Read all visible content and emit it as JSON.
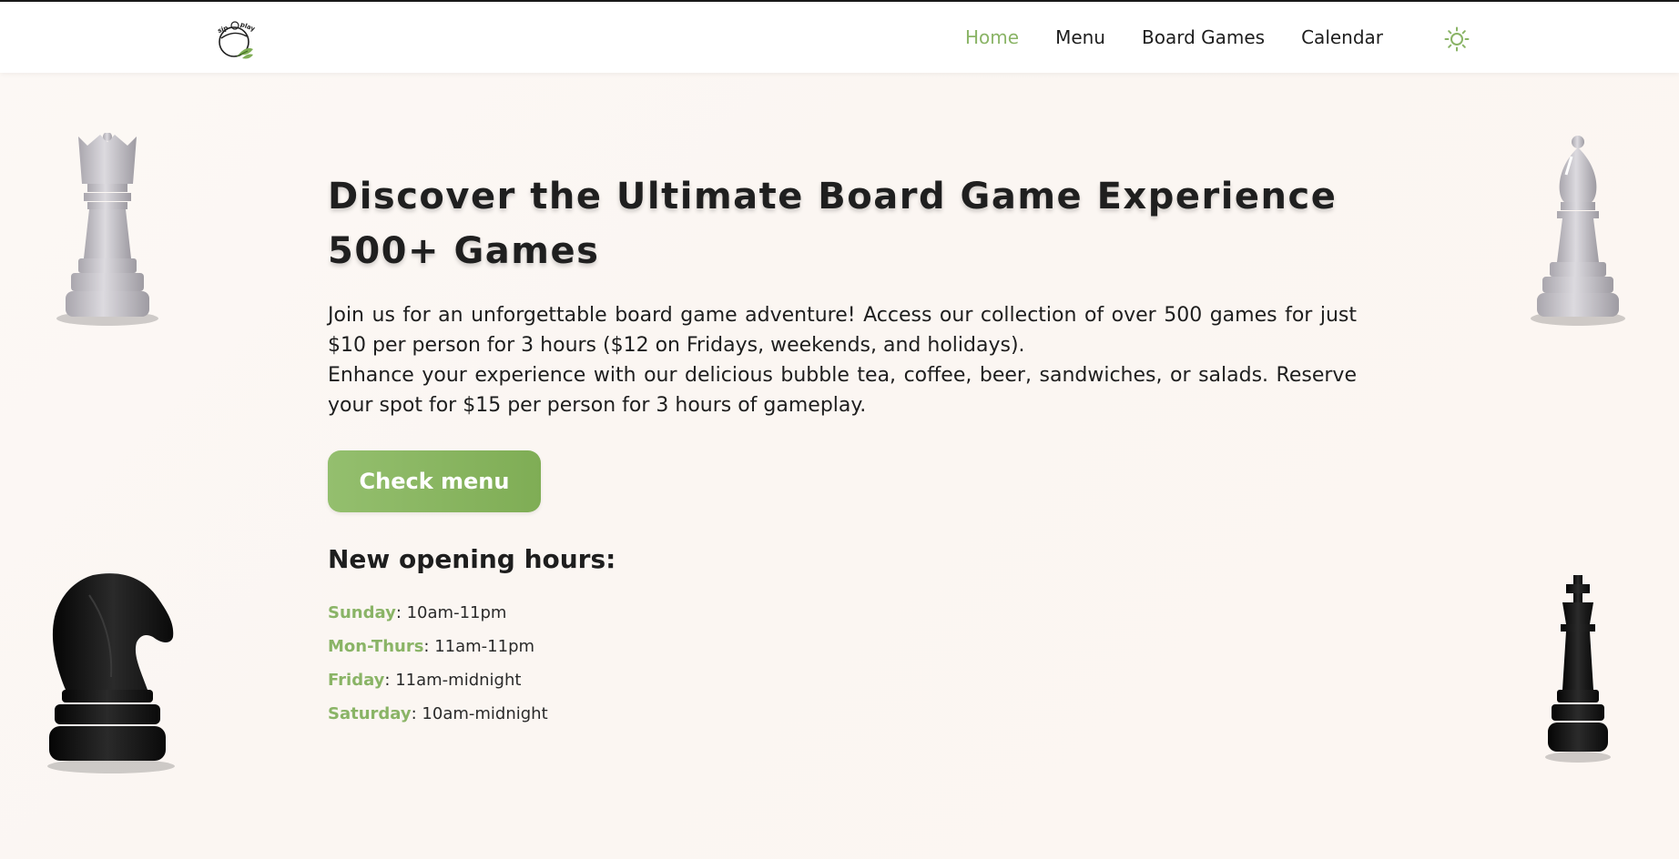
{
  "header": {
    "logo_text": "sip & play",
    "nav": [
      {
        "label": "Home",
        "active": true
      },
      {
        "label": "Menu",
        "active": false
      },
      {
        "label": "Board Games",
        "active": false
      },
      {
        "label": "Calendar",
        "active": false
      }
    ],
    "theme_icon": "sun-icon"
  },
  "hero": {
    "title_line1": "Discover the Ultimate Board Game Experience",
    "title_line2": "500+ Games",
    "paragraph1": "Join us for an unforgettable board game adventure! Access our collection of over 500 games for just $10 per person for 3 hours ($12 on Fridays, weekends, and holidays).",
    "paragraph2": "Enhance your experience with our delicious bubble tea, coffee, beer, sandwiches, or salads. Reserve your spot for $15 per person for 3 hours of gameplay.",
    "cta_label": "Check menu"
  },
  "hours": {
    "heading": "New opening hours:",
    "rows": [
      {
        "day": "Sunday",
        "time": ": 10am-11pm"
      },
      {
        "day": "Mon-Thurs",
        "time": ": 11am-11pm"
      },
      {
        "day": "Friday",
        "time": ": 11am-midnight"
      },
      {
        "day": "Saturday",
        "time": ": 10am-midnight"
      }
    ]
  },
  "decorations": {
    "pieces": [
      "white-queen-icon",
      "white-bishop-icon",
      "black-knight-icon",
      "black-king-icon"
    ]
  },
  "colors": {
    "accent": "#8ab466",
    "button": "#87b35e",
    "text": "#1e1e1e",
    "background": "#fcf8f5"
  }
}
